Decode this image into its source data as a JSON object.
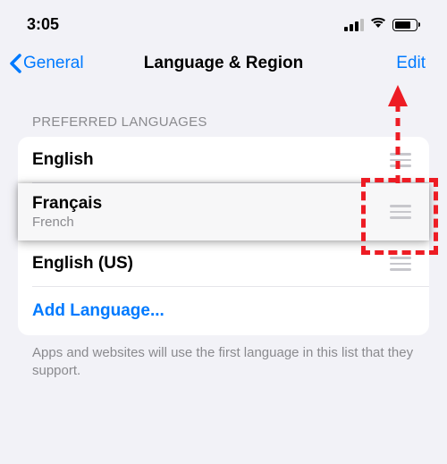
{
  "status": {
    "time": "3:05"
  },
  "nav": {
    "back_label": "General",
    "title": "Language & Region",
    "edit_label": "Edit"
  },
  "languages": {
    "section_header": "PREFERRED LANGUAGES",
    "item1": {
      "title": "English"
    },
    "item2": {
      "title": "Français",
      "subtitle": "French"
    },
    "item3": {
      "title": "English (US)"
    },
    "add_label": "Add Language..."
  },
  "footer": {
    "text": "Apps and websites will use the first language in this list that they support."
  }
}
